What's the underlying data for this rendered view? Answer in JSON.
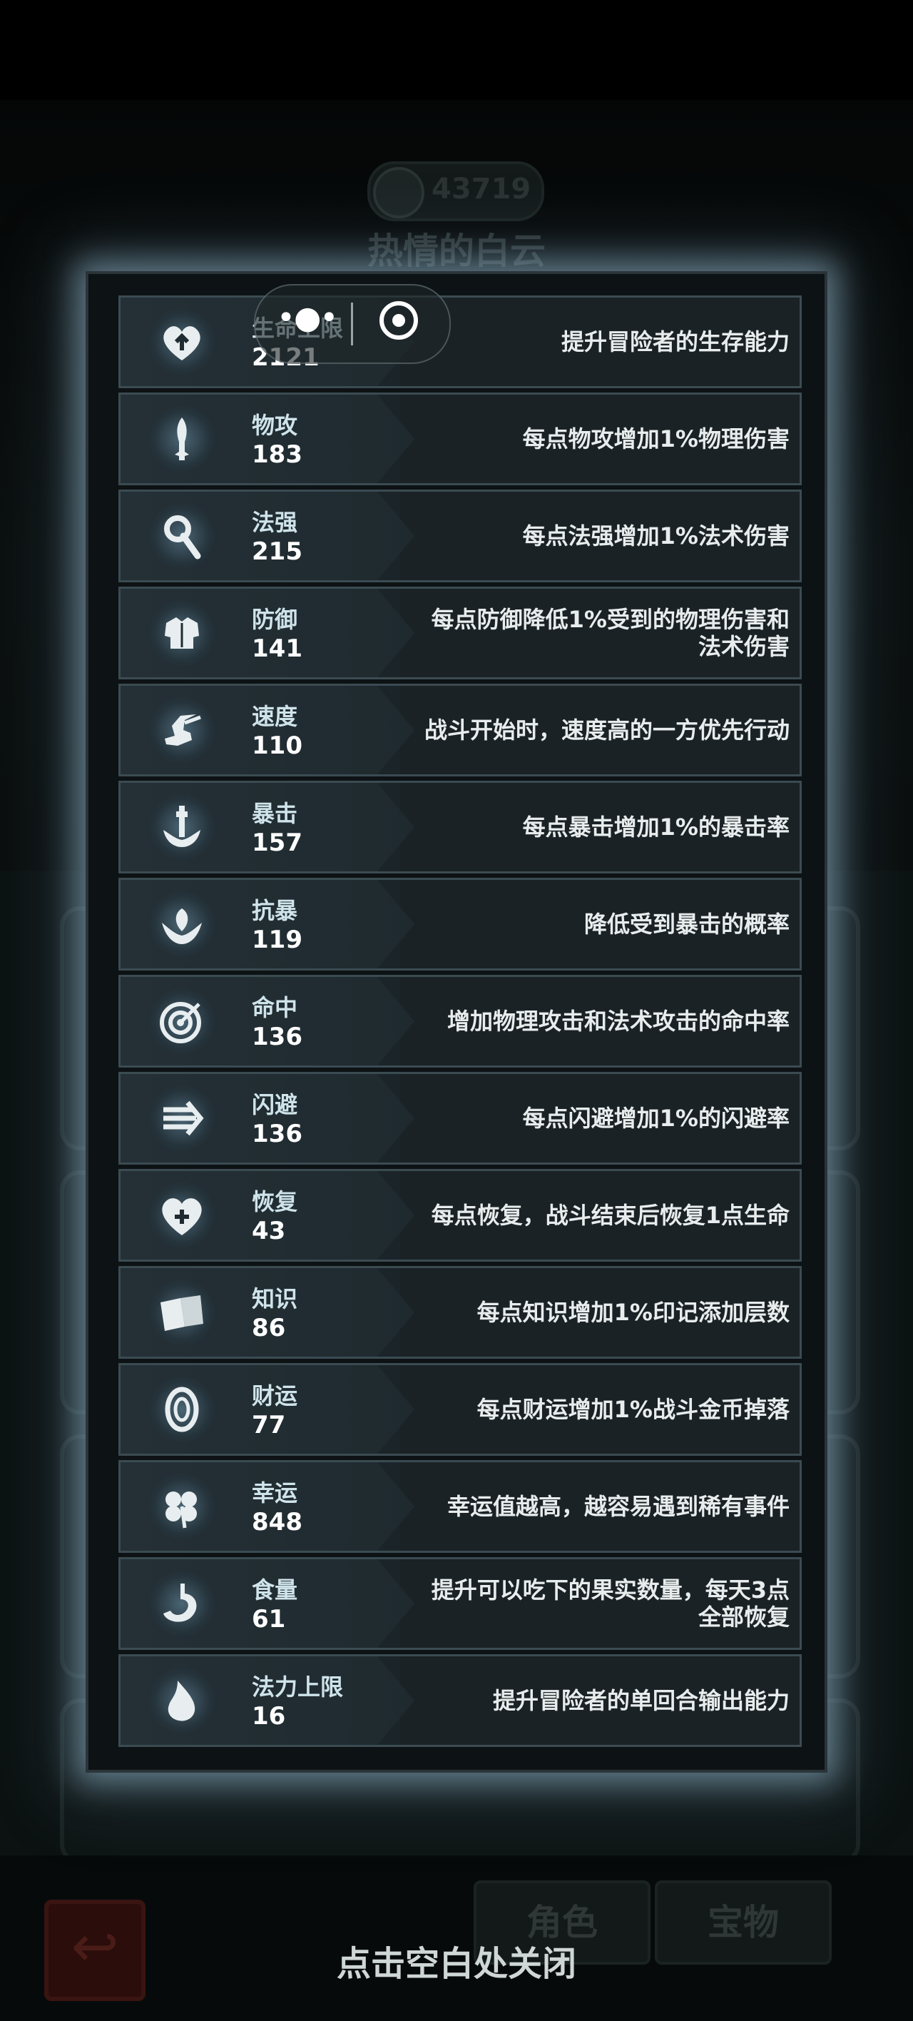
{
  "background": {
    "coins": "43719",
    "character_name": "热情的白云",
    "tabs": [
      "角色",
      "宝物"
    ]
  },
  "close_hint": "点击空白处关闭",
  "stats": [
    {
      "icon": "heart-arrow-icon",
      "name": "生命上限",
      "value": "2121",
      "desc": "提升冒险者的生存能力"
    },
    {
      "icon": "sword-icon",
      "name": "物攻",
      "value": "183",
      "desc": "每点物攻增加1%物理伤害"
    },
    {
      "icon": "magic-staff-icon",
      "name": "法强",
      "value": "215",
      "desc": "每点法强增加1%法术伤害"
    },
    {
      "icon": "armor-icon",
      "name": "防御",
      "value": "141",
      "desc": "每点防御降低1%受到的物理伤害和法术伤害"
    },
    {
      "icon": "winged-boot-icon",
      "name": "速度",
      "value": "110",
      "desc": "战斗开始时，速度高的一方优先行动"
    },
    {
      "icon": "critical-strike-icon",
      "name": "暴击",
      "value": "157",
      "desc": "每点暴击增加1%的暴击率"
    },
    {
      "icon": "crit-resist-icon",
      "name": "抗暴",
      "value": "119",
      "desc": "降低受到暴击的概率"
    },
    {
      "icon": "target-icon",
      "name": "命中",
      "value": "136",
      "desc": "增加物理攻击和法术攻击的命中率"
    },
    {
      "icon": "dodge-arrows-icon",
      "name": "闪避",
      "value": "136",
      "desc": "每点闪避增加1%的闪避率"
    },
    {
      "icon": "heart-plus-icon",
      "name": "恢复",
      "value": "43",
      "desc": "每点恢复，战斗结束后恢复1点生命"
    },
    {
      "icon": "book-icon",
      "name": "知识",
      "value": "86",
      "desc": "每点知识增加1%印记添加层数"
    },
    {
      "icon": "coin-icon",
      "name": "财运",
      "value": "77",
      "desc": "每点财运增加1%战斗金币掉落"
    },
    {
      "icon": "clover-icon",
      "name": "幸运",
      "value": "848",
      "desc": "幸运值越高，越容易遇到稀有事件"
    },
    {
      "icon": "stomach-icon",
      "name": "食量",
      "value": "61",
      "desc": "提升可以吃下的果实数量，每天3点全部恢复"
    },
    {
      "icon": "mana-drop-icon",
      "name": "法力上限",
      "value": "16",
      "desc": "提升冒险者的单回合输出能力"
    }
  ]
}
